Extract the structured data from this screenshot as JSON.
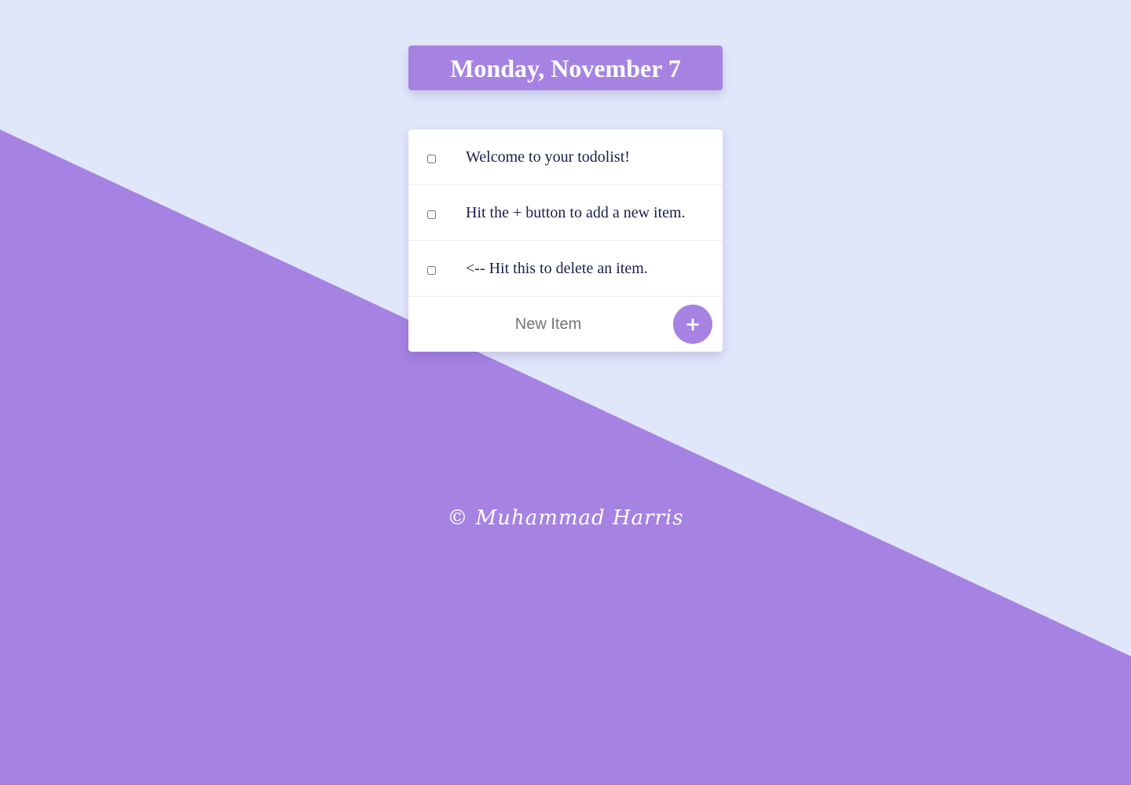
{
  "colors": {
    "background": "#e1e7fb",
    "accent": "#a683e2",
    "card": "#ffffff",
    "item_text": "#1a1f4d"
  },
  "heading": {
    "title": "Monday, November 7"
  },
  "todo": {
    "items": [
      {
        "text": "Welcome to your todolist!",
        "checked": false
      },
      {
        "text": "Hit the + button to add a new item.",
        "checked": false
      },
      {
        "text": "<-- Hit this to delete an item.",
        "checked": false
      }
    ],
    "new_item": {
      "placeholder": "New Item",
      "value": ""
    },
    "add_button": {
      "label": "+",
      "icon": "plus-icon"
    }
  },
  "footer": {
    "text": "© Muhammad Harris"
  }
}
